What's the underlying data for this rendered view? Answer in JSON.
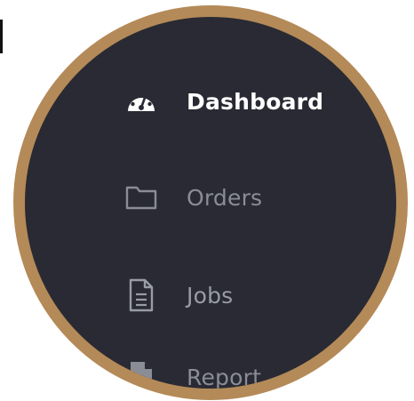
{
  "sidebar": {
    "items": [
      {
        "label": "Dashboard",
        "icon": "dashboard-gauge-icon",
        "active": true
      },
      {
        "label": "Orders",
        "icon": "folder-icon",
        "active": false
      },
      {
        "label": "Jobs",
        "icon": "document-icon",
        "active": false
      },
      {
        "label": "Report",
        "icon": "report-document-icon",
        "active": false
      }
    ]
  },
  "colors": {
    "frame": "#b48a58",
    "background": "#292a33",
    "active_text": "#ffffff",
    "inactive_text": "#8b8d96"
  }
}
